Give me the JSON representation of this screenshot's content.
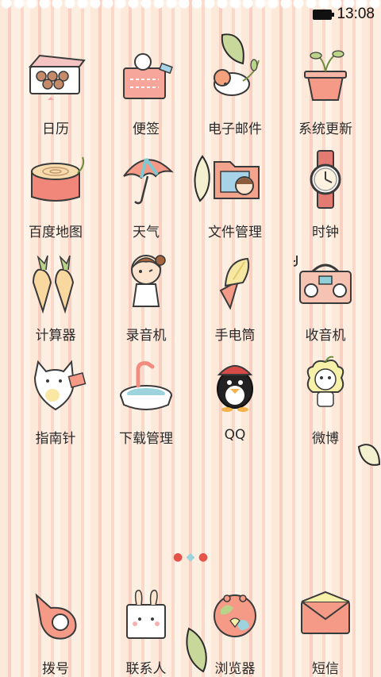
{
  "status_bar": {
    "time": "13:08"
  },
  "apps": [
    {
      "label": "日历",
      "icon": "calendar-gift-box-icon"
    },
    {
      "label": "便签",
      "icon": "notepad-bunny-icon"
    },
    {
      "label": "电子邮件",
      "icon": "bird-mail-icon"
    },
    {
      "label": "系统更新",
      "icon": "sprout-pot-icon"
    },
    {
      "label": "百度地图",
      "icon": "tree-stump-map-icon"
    },
    {
      "label": "天气",
      "icon": "umbrella-weather-icon"
    },
    {
      "label": "文件管理",
      "icon": "folder-icon"
    },
    {
      "label": "时钟",
      "icon": "wristwatch-icon"
    },
    {
      "label": "计算器",
      "icon": "carrots-calculator-icon"
    },
    {
      "label": "录音机",
      "icon": "girl-recorder-icon"
    },
    {
      "label": "手电筒",
      "icon": "ice-cream-flashlight-icon"
    },
    {
      "label": "收音机",
      "icon": "boombox-radio-icon"
    },
    {
      "label": "指南针",
      "icon": "cat-compass-icon"
    },
    {
      "label": "下载管理",
      "icon": "basin-download-icon"
    },
    {
      "label": "QQ",
      "icon": "penguin-qq-icon"
    },
    {
      "label": "微博",
      "icon": "yellow-creature-weibo-icon"
    }
  ],
  "page_indicator": {
    "pages": 3,
    "current": 1
  },
  "dock": [
    {
      "label": "拨号",
      "icon": "whistle-phone-icon"
    },
    {
      "label": "联系人",
      "icon": "bunny-box-contacts-icon"
    },
    {
      "label": "浏览器",
      "icon": "globe-browser-icon"
    },
    {
      "label": "短信",
      "icon": "envelope-sms-icon"
    }
  ]
}
